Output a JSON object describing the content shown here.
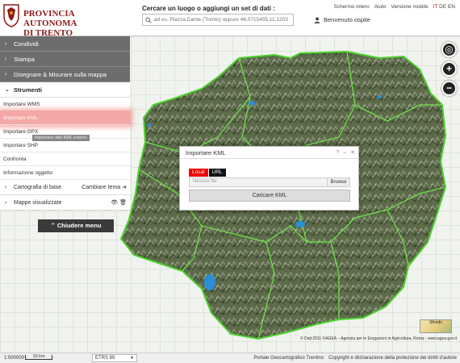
{
  "header": {
    "logo_line1": "PROVINCIA AUTONOMA",
    "logo_line2": "DI TRENTO",
    "search_label": "Cercare un luogo o aggiungi un set di dati :",
    "search_placeholder": "ad es. Piazza Dante (Trento) oppure 46.0715455,11.1203",
    "top_links": {
      "fullscreen": "Schermo intero",
      "help": "Aiuto",
      "mobile": "Versione mobile",
      "lang_it": "IT",
      "lang_de": "DE",
      "lang_en": "EN"
    },
    "user_label": "Benvenuto ospite",
    "colors": {
      "brand": "#8b1a1a",
      "lang_active": "#cc0000"
    }
  },
  "menu": {
    "items": [
      {
        "label": "Condividi",
        "icon": "chevron-right-icon"
      },
      {
        "label": "Stampa",
        "icon": "chevron-right-icon"
      },
      {
        "label": "Disegnare & Misurare sulla mappa",
        "icon": "chevron-right-icon"
      }
    ],
    "tools": {
      "label": "Strumenti",
      "icon": "chevron-down-icon",
      "subitems": [
        {
          "label": "Importare WMS"
        },
        {
          "label": "Importare KML",
          "active": true
        },
        {
          "label": "Importare GPX"
        },
        {
          "label": "Importare SHP"
        },
        {
          "label": "Confronta"
        },
        {
          "label": "Informazione oggetto"
        }
      ],
      "tooltip": "Importare dati KML esterni"
    },
    "basemap": {
      "label": "Cartografia di base",
      "right_label": "Cambiare tema"
    },
    "layers": {
      "label": "Mappe visualizzate"
    },
    "close_label": "Chiudere menu"
  },
  "dialog": {
    "title": "Importare KML",
    "tabs": {
      "local": "Local",
      "url": "URL"
    },
    "file_placeholder": "Nessun file",
    "browse_label": "Browse",
    "load_label": "Caricare KML"
  },
  "map": {
    "attribution": "© Dati:2011 ©AGEA – Agenzia per le Erogazioni in Agricoltura, Roma - www.agea.gov.it",
    "basemap_thumb_label": "Sfondo"
  },
  "footer": {
    "scale": "1:500000",
    "scale_bar": "10 km",
    "crs": "ETRS 89",
    "portal": "Portale Geocartografico Trentino",
    "copyright": "Copyright e dichiarazione della protezione dei diritti d'autore"
  }
}
